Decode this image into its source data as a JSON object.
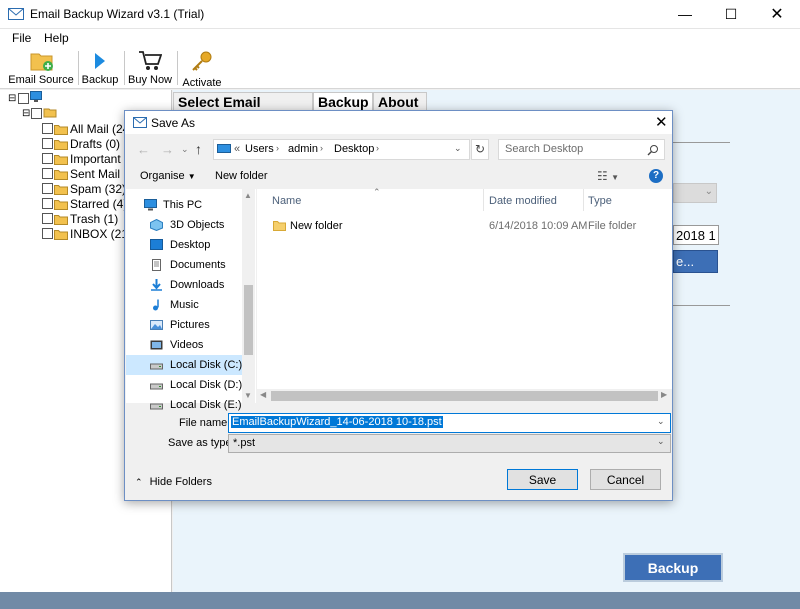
{
  "app": {
    "title": "Email Backup Wizard v3.1 (Trial)",
    "menu": [
      "File",
      "Help"
    ],
    "toolbar": {
      "email_source": "Email Source",
      "backup": "Backup",
      "buy_now": "Buy Now",
      "activate": "Activate"
    },
    "tree": {
      "items": [
        {
          "label": "All Mail (24"
        },
        {
          "label": "Drafts (0)"
        },
        {
          "label": "Important (1"
        },
        {
          "label": "Sent Mail (2"
        },
        {
          "label": "Spam (32)"
        },
        {
          "label": "Starred (4)"
        },
        {
          "label": "Trash (1)"
        },
        {
          "label": "INBOX (210"
        }
      ]
    },
    "tabs": [
      "Select Email Source",
      "Backup",
      "About"
    ],
    "right_fragments": {
      "date": "2018 1",
      "browse": "e..."
    },
    "backup_button": "Backup"
  },
  "dialog": {
    "title": "Save As",
    "address_parts": [
      "Users",
      "admin",
      "Desktop"
    ],
    "search_placeholder": "Search Desktop",
    "organise": "Organise",
    "new_folder": "New folder",
    "nav": [
      {
        "label": "This PC",
        "icon": "computer-icon"
      },
      {
        "label": "3D Objects",
        "icon": "cube-icon"
      },
      {
        "label": "Desktop",
        "icon": "desktop-icon"
      },
      {
        "label": "Documents",
        "icon": "document-icon"
      },
      {
        "label": "Downloads",
        "icon": "download-icon"
      },
      {
        "label": "Music",
        "icon": "music-icon"
      },
      {
        "label": "Pictures",
        "icon": "picture-icon"
      },
      {
        "label": "Videos",
        "icon": "video-icon"
      },
      {
        "label": "Local Disk (C:)",
        "icon": "drive-icon",
        "selected": true
      },
      {
        "label": "Local Disk (D:)",
        "icon": "drive-icon"
      },
      {
        "label": "Local Disk (E:)",
        "icon": "drive-icon"
      }
    ],
    "columns": {
      "name": "Name",
      "date": "Date modified",
      "type": "Type"
    },
    "files": [
      {
        "name": "New folder",
        "date": "6/14/2018 10:09 AM",
        "type": "File folder"
      }
    ],
    "file_name_label": "File name:",
    "file_name_value": "EmailBackupWizard_14-06-2018 10-18.pst",
    "save_type_label": "Save as type:",
    "save_type_value": "*.pst",
    "hide_folders": "Hide Folders",
    "save": "Save",
    "cancel": "Cancel"
  }
}
